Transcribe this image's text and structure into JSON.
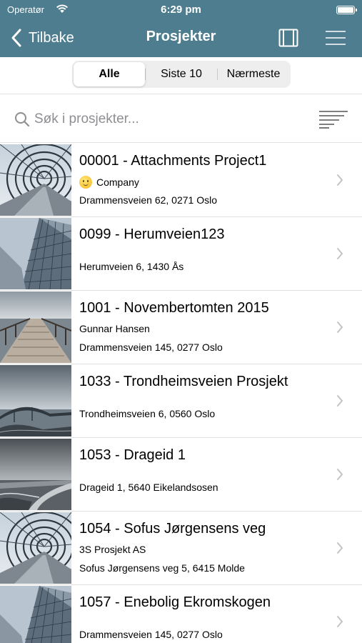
{
  "status_bar": {
    "carrier": "Operatør",
    "time": "6:29 pm"
  },
  "nav": {
    "back_label": "Tilbake",
    "title": "Prosjekter",
    "bar_color": "#4d7d8e"
  },
  "segments": {
    "options": [
      "Alle",
      "Siste 10",
      "Nærmeste"
    ],
    "selected": "Alle"
  },
  "search": {
    "placeholder": "Søk i prosjekter...",
    "value": ""
  },
  "projects": [
    {
      "title": "00001 - Attachments Project1",
      "subtitle": "Company",
      "subtitle_icon": "smiley-emoji-icon",
      "address": "Drammensveien 62, 0271 Oslo",
      "thumbnail": "tunnel-bridge-image"
    },
    {
      "title": "0099 - Herumveien123",
      "subtitle": "",
      "address": "Herumveien 6, 1430 Ås",
      "thumbnail": "glass-building-image"
    },
    {
      "title": "1001 - Novembertomten 2015",
      "subtitle": "Gunnar Hansen",
      "address": "Drammensveien 145, 0277 Oslo",
      "thumbnail": "pier-image"
    },
    {
      "title": "1033 - Trondheimsveien Prosjekt",
      "subtitle": "",
      "address": "Trondheimsveien 6, 0560 Oslo",
      "thumbnail": "coastal-bridge-image"
    },
    {
      "title": "1053 - Drageid 1",
      "subtitle": "",
      "address": "Drageid 1, 5640 Eikelandsosen",
      "thumbnail": "sea-wall-image"
    },
    {
      "title": "1054 - Sofus Jørgensens veg",
      "subtitle": "3S Prosjekt AS",
      "address": "Sofus Jørgensens veg 5, 6415 Molde",
      "thumbnail": "tunnel-bridge-image"
    },
    {
      "title": "1057 - Enebolig Ekromskogen",
      "subtitle": "",
      "address": "Drammensveien 145, 0277 Oslo",
      "thumbnail": "glass-building-image"
    }
  ]
}
